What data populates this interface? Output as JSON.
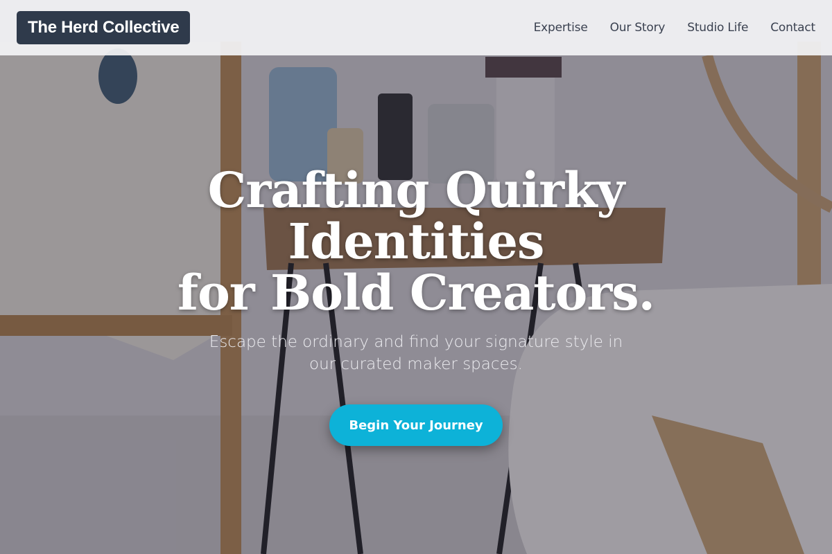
{
  "header": {
    "brand": "The Herd Collective",
    "nav": [
      {
        "label": "Expertise"
      },
      {
        "label": "Our Story"
      },
      {
        "label": "Studio Life"
      },
      {
        "label": "Contact"
      }
    ]
  },
  "hero": {
    "title_line1": "Crafting Quirky Identities",
    "title_line2": "for Bold Creators.",
    "subtitle": "Escape the ordinary and find your signature style in our curated maker spaces.",
    "cta_label": "Begin Your Journey"
  },
  "colors": {
    "brand_bg": "#2f3a4b",
    "cta_bg": "#0db2d8",
    "header_bg": "#f3f3f5"
  }
}
